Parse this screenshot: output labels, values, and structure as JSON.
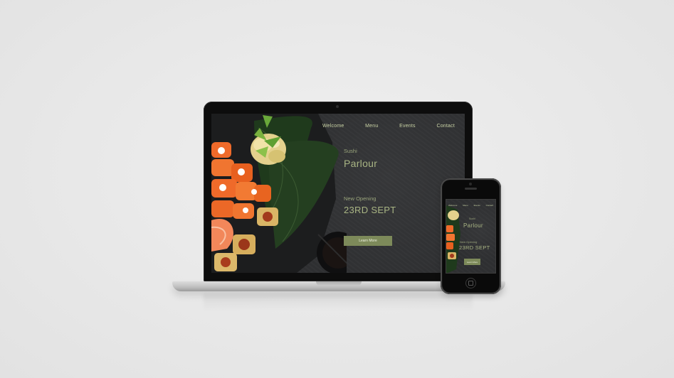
{
  "site": {
    "nav": [
      "Welcome",
      "Menu",
      "Events",
      "Contact"
    ],
    "kicker_top": "Sushi",
    "title": "Parlour",
    "kicker_bottom": "New Opening",
    "date": "23RD SEPT",
    "cta": "Learn More"
  },
  "colors": {
    "backdrop": "#e8e8e8",
    "slate": "#2f3032",
    "accent_text": "#a9b584",
    "nav_text": "#c9d3a5",
    "button": "#7d8a5a",
    "salmon": "#ef6a2a"
  },
  "icons": {
    "home_button": "phone-home-button-icon",
    "camera": "camera-icon"
  }
}
